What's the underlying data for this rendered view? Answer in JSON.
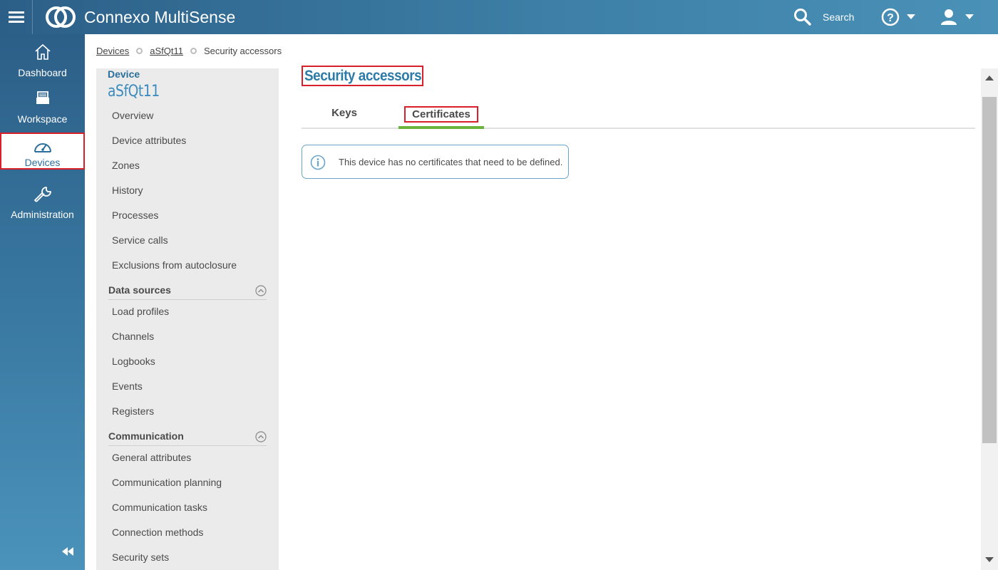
{
  "header": {
    "app_title": "Connexo MultiSense",
    "search_label": "Search"
  },
  "nav": {
    "items": [
      {
        "label": "Dashboard",
        "icon": "home-icon"
      },
      {
        "label": "Workspace",
        "icon": "workspace-icon"
      },
      {
        "label": "Devices",
        "icon": "gauge-icon",
        "active": true
      },
      {
        "label": "Administration",
        "icon": "wrench-icon"
      }
    ]
  },
  "breadcrumb": {
    "items": [
      "Devices",
      "aSfQt11",
      "Security accessors"
    ]
  },
  "side": {
    "device_label": "Device",
    "device_name": "aSfQt11",
    "links": [
      "Overview",
      "Device attributes",
      "Zones",
      "History",
      "Processes",
      "Service calls",
      "Exclusions from autoclosure"
    ],
    "data_sources": {
      "title": "Data sources",
      "links": [
        "Load profiles",
        "Channels",
        "Logbooks",
        "Events",
        "Registers"
      ]
    },
    "communication": {
      "title": "Communication",
      "links": [
        "General attributes",
        "Communication planning",
        "Communication tasks",
        "Connection methods",
        "Security sets"
      ]
    }
  },
  "main": {
    "title": "Security accessors",
    "tabs": [
      "Keys",
      "Certificates"
    ],
    "active_tab": "Certificates",
    "info_message": "This device has no certificates that need to be defined."
  },
  "colors": {
    "accent": "#2b7aa8",
    "active_tab_underline": "#6cb33e",
    "highlight_border": "#d9202a"
  }
}
